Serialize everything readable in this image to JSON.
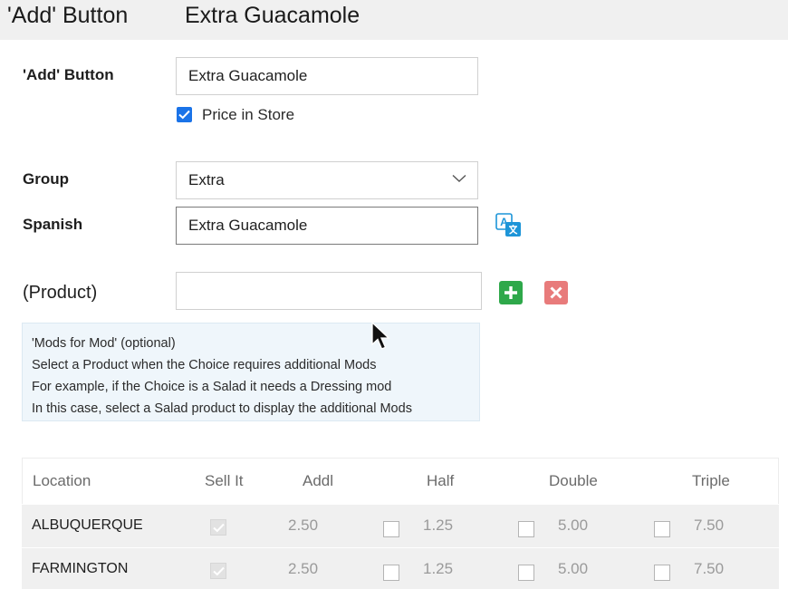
{
  "header": {
    "title_left": "'Add' Button",
    "title_right": "Extra Guacamole"
  },
  "form": {
    "add_button_label": "'Add' Button",
    "add_button_value": "Extra Guacamole",
    "price_in_store_label": "Price in Store",
    "price_in_store_checked": true,
    "group_label": "Group",
    "group_value": "Extra",
    "spanish_label": "Spanish",
    "spanish_value": "Extra Guacamole",
    "product_label": "(Product)",
    "product_value": ""
  },
  "info": {
    "line1": "'Mods for Mod' (optional)",
    "line2": "Select a Product when the Choice requires additional Mods",
    "line3": "For example, if the Choice is a Salad it needs a Dressing mod",
    "line4": "In this case, select a Salad product to display the additional Mods"
  },
  "table": {
    "headers": {
      "location": "Location",
      "sell_it": "Sell It",
      "addl": "Addl",
      "half": "Half",
      "double": "Double",
      "triple": "Triple"
    },
    "rows": [
      {
        "location": "ALBUQUERQUE",
        "sell_it": true,
        "addl": "2.50",
        "half": "1.25",
        "double": "5.00",
        "triple": "7.50"
      },
      {
        "location": "FARMINGTON",
        "sell_it": true,
        "addl": "2.50",
        "half": "1.25",
        "double": "5.00",
        "triple": "7.50"
      }
    ]
  },
  "icons": {
    "translate": "translate-icon",
    "add": "add-icon",
    "remove": "remove-icon",
    "dropdown": "chevron-down-icon",
    "cursor": "mouse-cursor-icon"
  },
  "colors": {
    "checkbox_blue": "#1a73e8",
    "add_green": "#2ea84a",
    "remove_red": "#e87b7b",
    "translate_blue": "#1d95d8",
    "info_bg": "#eff6fb",
    "header_bg": "#f0f0f0",
    "row_bg": "#f0f0f0"
  }
}
